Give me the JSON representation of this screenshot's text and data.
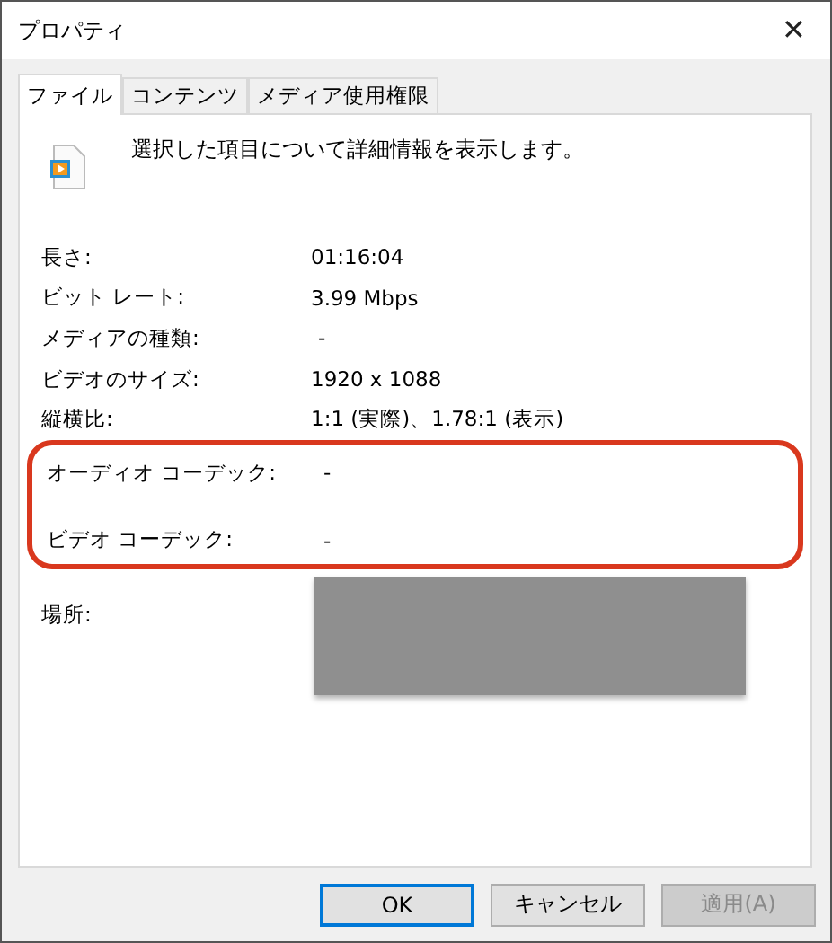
{
  "window": {
    "title": "プロパティ",
    "close": "✕"
  },
  "tabs": [
    {
      "label": "ファイル",
      "selected": true
    },
    {
      "label": "コンテンツ",
      "selected": false
    },
    {
      "label": "メディア使用権限",
      "selected": false
    }
  ],
  "description": "選択した項目について詳細情報を表示します。",
  "details": [
    {
      "label": "長さ:",
      "value": "01:16:04",
      "highlighted": false
    },
    {
      "label": "ビット レート:",
      "value": "3.99 Mbps",
      "highlighted": false
    },
    {
      "label": "メディアの種類:",
      "value": "-",
      "highlighted": false
    },
    {
      "label": "ビデオのサイズ:",
      "value": "1920 x 1088",
      "highlighted": false
    },
    {
      "label": "縦横比:",
      "value": "1:1 (実際)、1.78:1 (表示)",
      "highlighted": false
    },
    {
      "label": "オーディオ コーデック:",
      "value": "-",
      "highlighted": true
    },
    {
      "label": "ビデオ コーデック:",
      "value": "-",
      "highlighted": true
    }
  ],
  "location": {
    "label": "場所:",
    "redacted": true
  },
  "buttons": [
    {
      "label": "OK",
      "default": true,
      "disabled": false
    },
    {
      "label": "キャンセル",
      "default": false,
      "disabled": false
    },
    {
      "label": "適用(A)",
      "default": false,
      "disabled": true
    }
  ]
}
